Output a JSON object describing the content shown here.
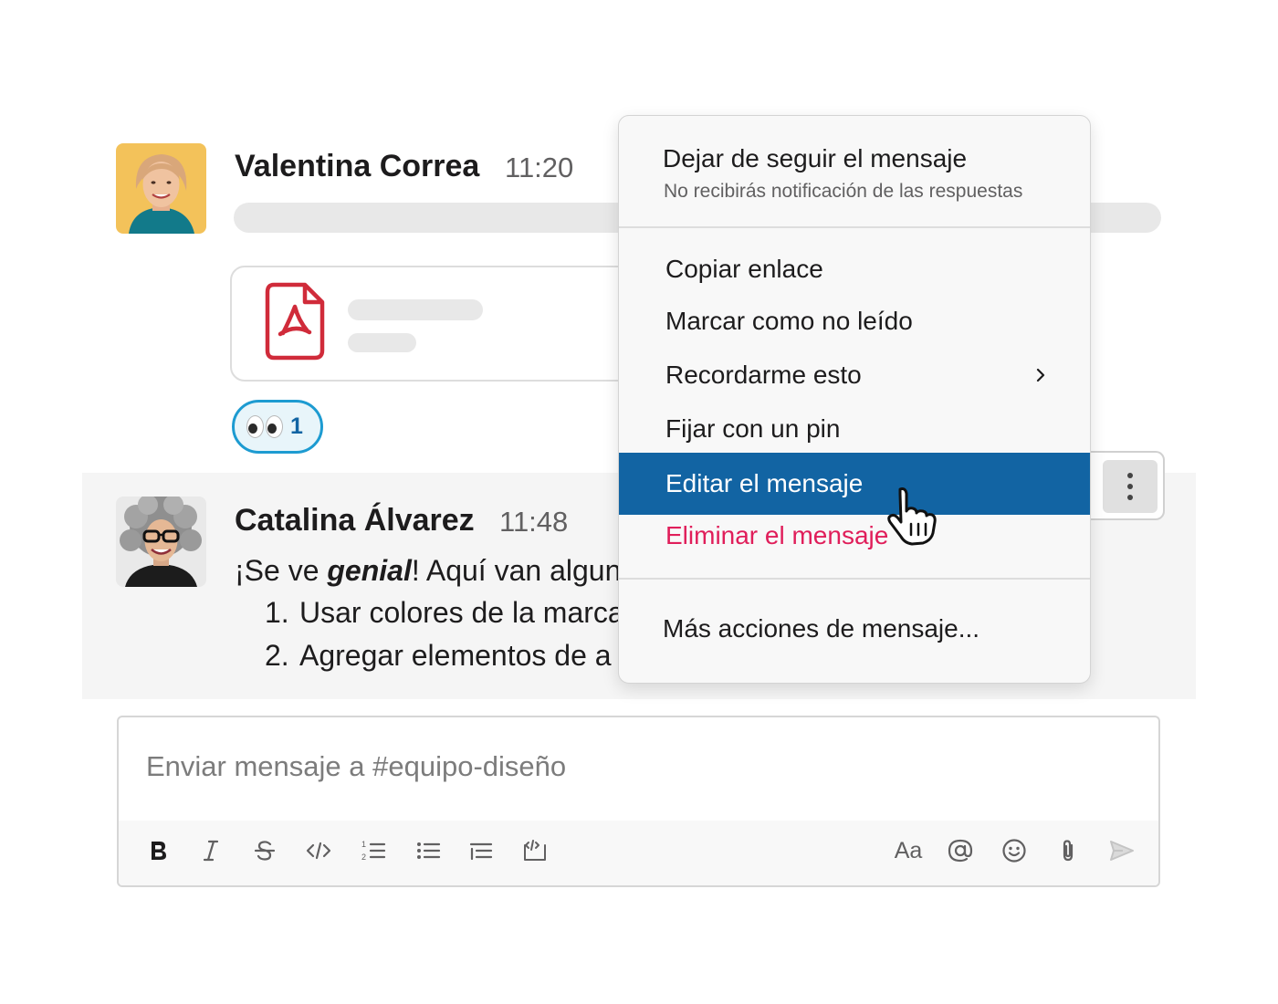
{
  "messages": [
    {
      "author": "Valentina Correa",
      "time": "11:20",
      "attachment_icon": "pdf-icon",
      "reaction": {
        "emoji": "eyes",
        "count": "1"
      }
    },
    {
      "author": "Catalina Álvarez",
      "time": "11:48",
      "text_prefix": "¡Se ve ",
      "text_emphasis": "genial",
      "text_suffix": "! Aquí van algunas",
      "list": [
        {
          "num": "1.",
          "text": "Usar colores de la marca"
        },
        {
          "num": "2.",
          "text": "Agregar elementos de a"
        }
      ]
    }
  ],
  "context_menu": {
    "header_title": "Dejar de seguir el mensaje",
    "header_subtitle": "No recibirás notificación de las respuestas",
    "items": [
      {
        "label": "Copiar enlace"
      },
      {
        "label": "Marcar como no leído"
      },
      {
        "label": "Recordarme esto",
        "submenu": true
      },
      {
        "label": "Fijar con un pin"
      },
      {
        "label": "Editar el mensaje",
        "highlighted": true
      },
      {
        "label": "Eliminar el mensaje",
        "destructive": true
      }
    ],
    "footer_item": "Más acciones de mensaje..."
  },
  "composer": {
    "placeholder": "Enviar mensaje a #equipo-diseño",
    "format_button_label": "Aa",
    "toolbar_icons": [
      "bold-icon",
      "italic-icon",
      "strikethrough-icon",
      "code-icon",
      "ordered-list-icon",
      "bulleted-list-icon",
      "blockquote-icon",
      "code-block-icon",
      "text-format-icon",
      "mention-icon",
      "emoji-icon",
      "attachment-icon",
      "send-icon"
    ]
  },
  "colors": {
    "highlight": "#1264a3",
    "destructive": "#e01e5a",
    "reaction_border": "#1d9bd1",
    "pdf_red": "#d02b3a"
  }
}
